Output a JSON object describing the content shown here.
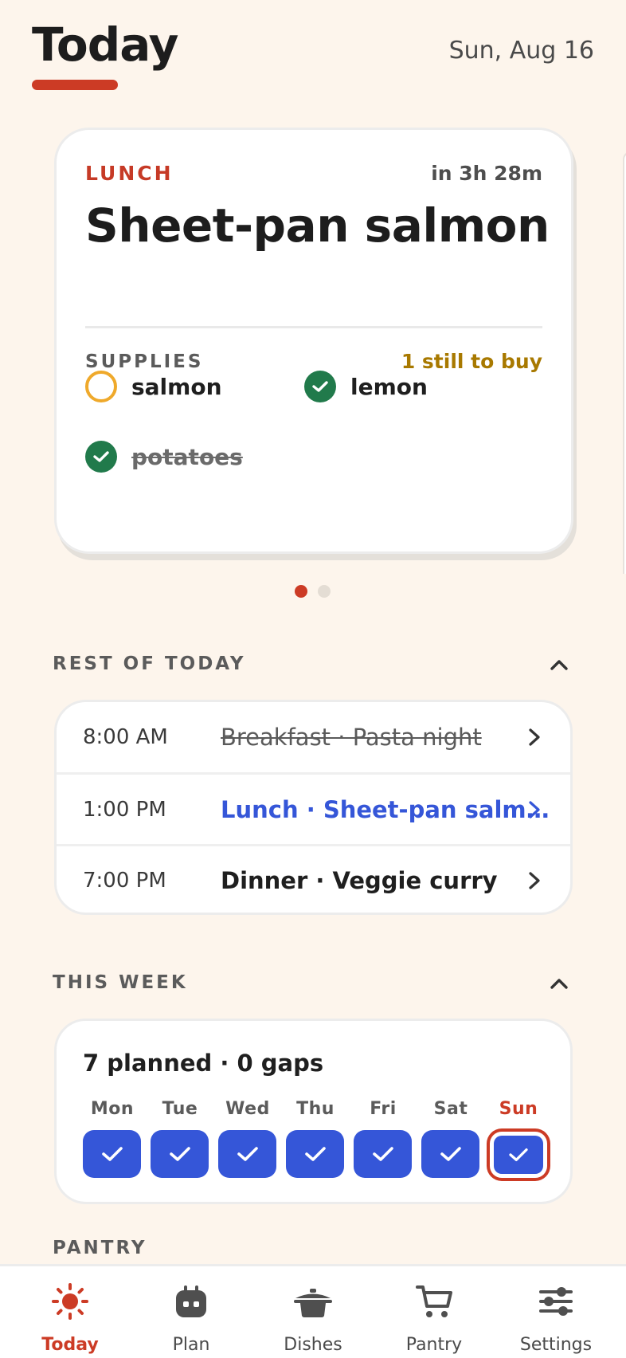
{
  "header": {
    "title": "Today",
    "date": "Sun, Aug 16"
  },
  "hero": {
    "meal_label": "LUNCH",
    "countdown": "in 3h 28m",
    "dish": "Sheet-pan salmon",
    "supplies_title": "SUPPLIES",
    "supplies_status": "1 still to buy",
    "supplies": [
      {
        "name": "salmon",
        "status": "to-buy"
      },
      {
        "name": "lemon",
        "status": "have"
      },
      {
        "name": "potatoes",
        "status": "have-struck"
      }
    ]
  },
  "pager": {
    "count": 2,
    "active": 0
  },
  "rest_of_today": {
    "title": "REST OF TODAY",
    "rows": [
      {
        "time": "8:00 AM",
        "meal": "Breakfast · Pasta night",
        "state": "past"
      },
      {
        "time": "1:00 PM",
        "meal": "Lunch · Sheet-pan salm…",
        "state": "current"
      },
      {
        "time": "7:00 PM",
        "meal": "Dinner · Veggie curry",
        "state": "upcoming"
      }
    ]
  },
  "this_week": {
    "title": "THIS WEEK",
    "summary": "7 planned · 0 gaps",
    "days": [
      "Mon",
      "Tue",
      "Wed",
      "Thu",
      "Fri",
      "Sat",
      "Sun"
    ],
    "today_day": "Sun"
  },
  "pantry": {
    "title": "PANTRY"
  },
  "nav": {
    "items": [
      {
        "label": "Today",
        "icon": "sun-icon",
        "active": true
      },
      {
        "label": "Plan",
        "icon": "robot-icon",
        "active": false
      },
      {
        "label": "Dishes",
        "icon": "pot-icon",
        "active": false
      },
      {
        "label": "Pantry",
        "icon": "cart-icon",
        "active": false
      },
      {
        "label": "Settings",
        "icon": "sliders-icon",
        "active": false
      }
    ]
  },
  "colors": {
    "accent": "#cc3b25",
    "primary": "#3556d8",
    "success": "#217a4b",
    "warning": "#efa92b",
    "background": "#fdf5ec"
  }
}
